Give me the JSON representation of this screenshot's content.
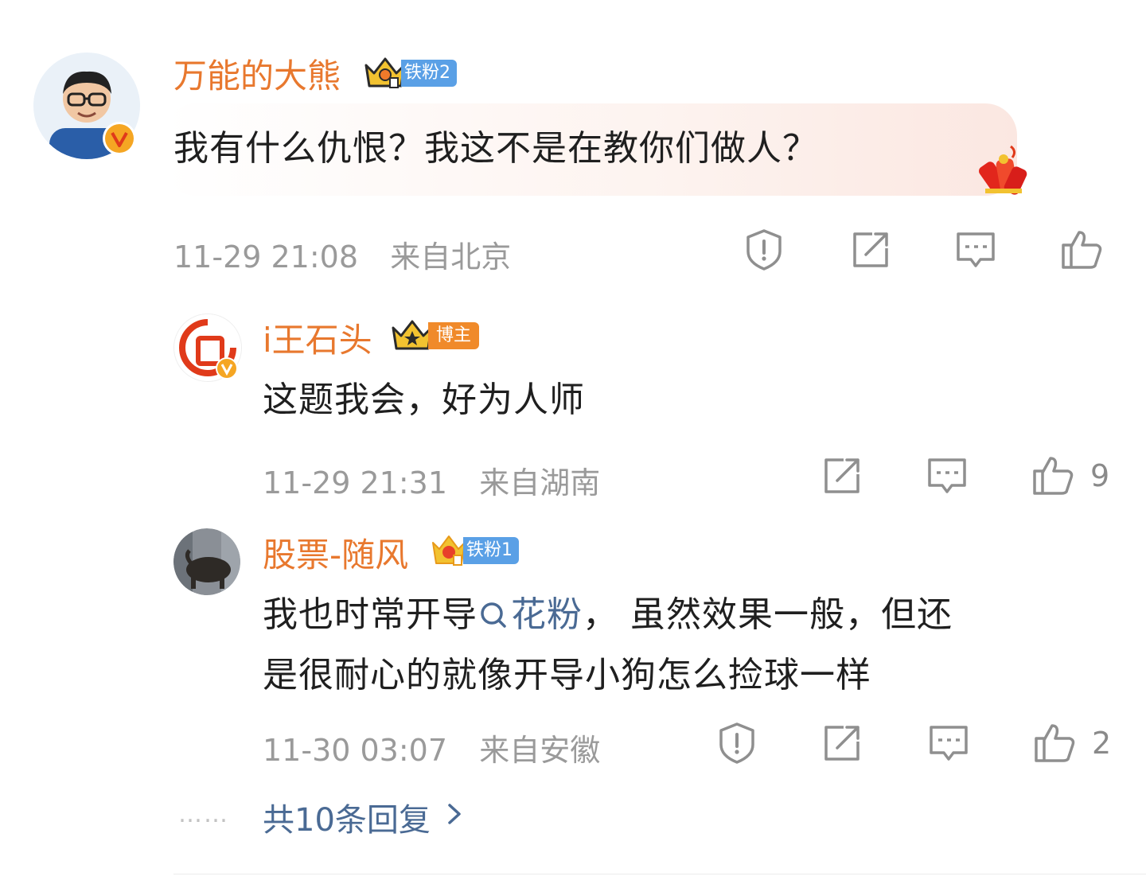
{
  "comment": {
    "username": "万能的大熊",
    "badge_label": "铁粉2",
    "content": "我有什么仇恨？我这不是在教你们做人？",
    "time": "11-29 21:08",
    "location": "来自北京"
  },
  "replies": [
    {
      "username": "i王石头",
      "badge_label": "博主",
      "content": "这题我会，好为人师",
      "time": "11-29 21:31",
      "location": "来自湖南",
      "like_count": "9"
    },
    {
      "username": "股票-随风",
      "badge_label": "铁粉1",
      "content_line1_a": "我也时常开导",
      "topic": "花粉",
      "content_line1_b": "，  虽然效果一般，但还",
      "content_line2": "是很耐心的就像开导小狗怎么捡球一样",
      "time": "11-30 03:07",
      "location": "来自安徽",
      "like_count": "2"
    }
  ],
  "more_replies": {
    "dots": "……",
    "label": "共10条回复"
  },
  "icons": [
    "report-icon",
    "share-icon",
    "comment-icon",
    "like-icon",
    "verified-icon",
    "crown-icon",
    "search-topic-icon",
    "chevron-right-icon",
    "firecracker-icon"
  ],
  "colors": {
    "username": "#e8782e",
    "link": "#4a6a94",
    "meta": "#9a9a9a",
    "fan_badge": "#5aa0e6",
    "blogger_badge": "#f08a2a",
    "verified": "#f5a623"
  }
}
